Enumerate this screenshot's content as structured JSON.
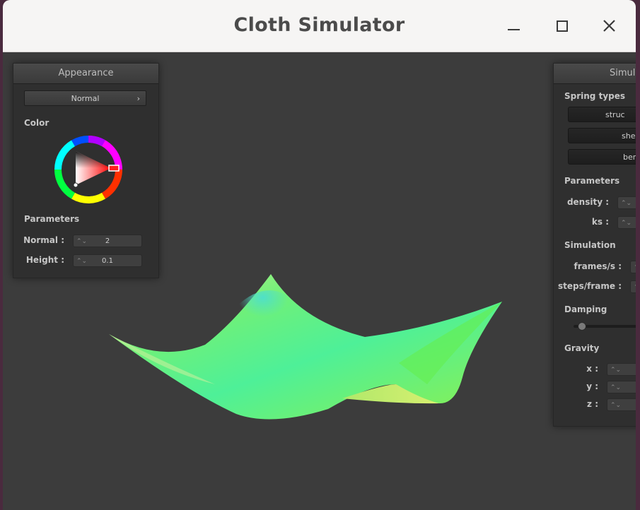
{
  "window": {
    "title": "Cloth Simulator",
    "controls": [
      "minimize-icon",
      "maximize-icon",
      "close-icon"
    ],
    "background_color": "#3c3c3c"
  },
  "appearance_panel": {
    "header": "Appearance",
    "shader_dropdown": {
      "selected": "Normal",
      "chevron": "›"
    },
    "color_label": "Color",
    "color_picker": {
      "selected_color": "#ff0000"
    },
    "parameters_label": "Parameters",
    "params": [
      {
        "label": "Normal :",
        "value": "2"
      },
      {
        "label": "Height :",
        "value": "0.1"
      }
    ]
  },
  "simulation_panel": {
    "header": "Simul",
    "spring_types_label": "Spring types",
    "spring_buttons": [
      "struc",
      "shea",
      "bend"
    ],
    "parameters_label": "Parameters",
    "params": [
      {
        "label": "density :"
      },
      {
        "label": "ks :"
      }
    ],
    "simulation_label": "Simulation",
    "sim_params": [
      {
        "label": "frames/s :"
      },
      {
        "label": "steps/frame :"
      }
    ],
    "damping_label": "Damping",
    "damping_level": 0.1,
    "gravity_label": "Gravity",
    "gravity": [
      {
        "label": "x :"
      },
      {
        "label": "y :"
      },
      {
        "label": "z :"
      }
    ]
  }
}
